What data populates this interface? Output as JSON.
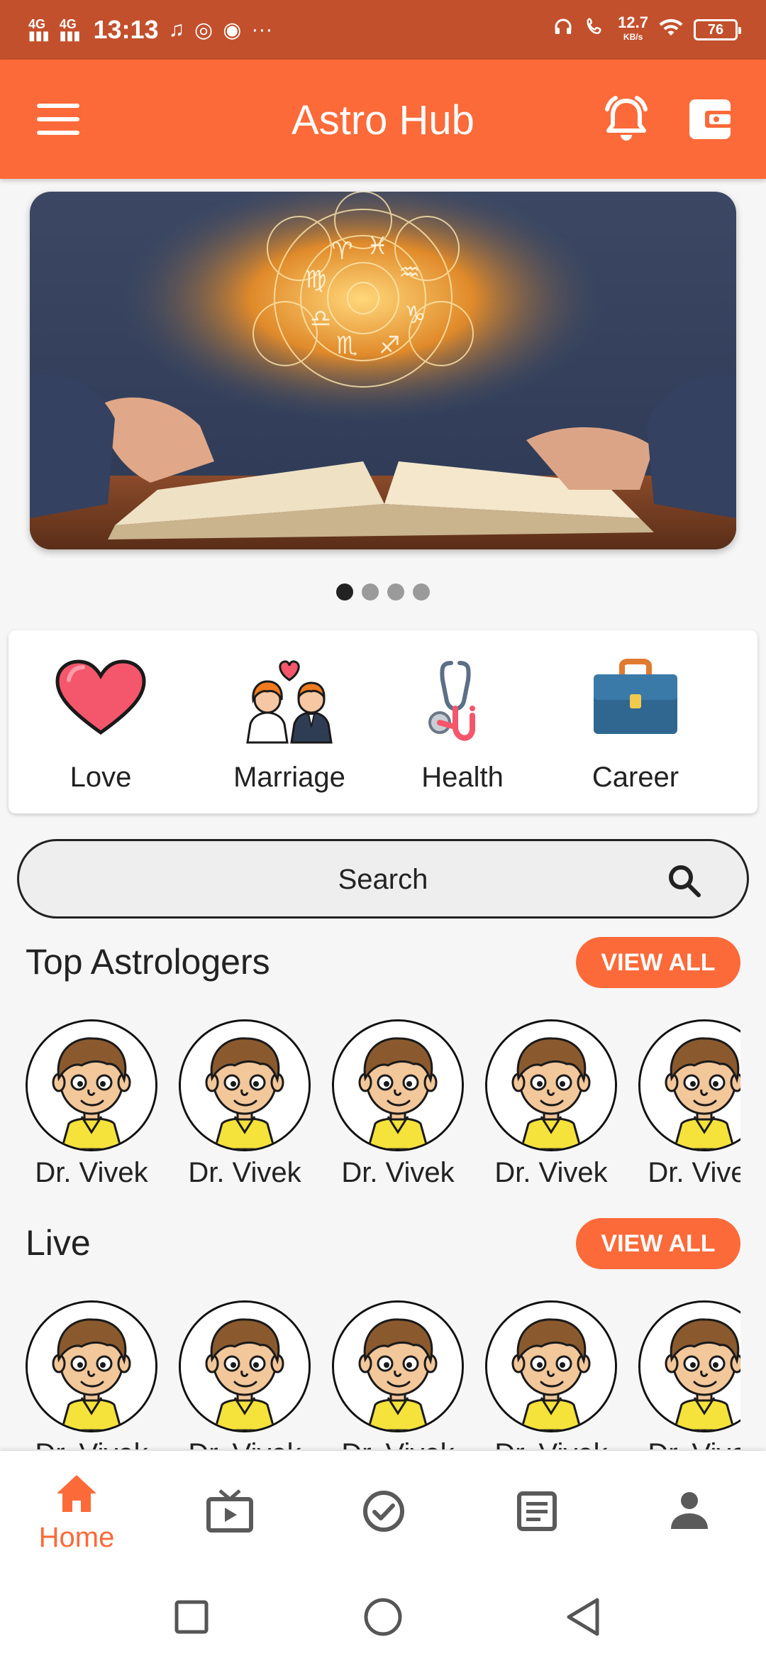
{
  "status_bar": {
    "network_1": "4G",
    "network_2": "4G",
    "time": "13:13",
    "speed_value": "12.7",
    "speed_unit": "KB/s",
    "battery": "76"
  },
  "app_bar": {
    "title": "Astro Hub",
    "background": "#fc6a39"
  },
  "banner": {
    "slides": 4,
    "active_index": 0
  },
  "categories": [
    {
      "label": "Love",
      "icon": "heart-icon"
    },
    {
      "label": "Marriage",
      "icon": "couple-icon"
    },
    {
      "label": "Health",
      "icon": "stethoscope-icon"
    },
    {
      "label": "Career",
      "icon": "briefcase-icon"
    }
  ],
  "search": {
    "placeholder": "Search"
  },
  "top_astrologers": {
    "title": "Top Astrologers",
    "view_all": "VIEW ALL",
    "items": [
      "Dr. Vivek",
      "Dr. Vivek",
      "Dr. Vivek",
      "Dr. Vivek",
      "Dr. Vivek"
    ]
  },
  "live": {
    "title": "Live",
    "view_all": "VIEW ALL",
    "items": [
      "Dr. Vivek",
      "Dr. Vivek",
      "Dr. Vivek",
      "Dr. Vivek",
      "Dr. Vivek"
    ]
  },
  "bottom_nav": {
    "active": "Home",
    "items": [
      {
        "label": "Home",
        "icon": "home-icon"
      },
      {
        "label": "",
        "icon": "live-tv-icon"
      },
      {
        "label": "",
        "icon": "check-circle-icon"
      },
      {
        "label": "",
        "icon": "article-icon"
      },
      {
        "label": "",
        "icon": "person-icon"
      }
    ]
  },
  "colors": {
    "accent": "#fc6a39",
    "status_bar": "#c2502c"
  }
}
